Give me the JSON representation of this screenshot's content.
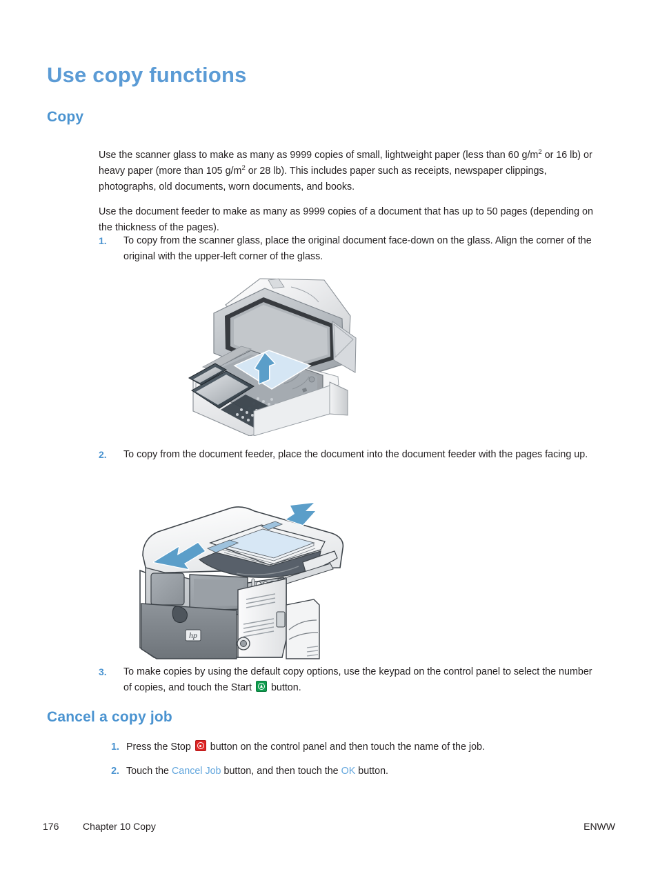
{
  "document": {
    "title": "Use copy functions",
    "sections": [
      {
        "id": "copy",
        "heading": "Copy"
      },
      {
        "id": "cancel",
        "heading": "Cancel a copy job"
      }
    ]
  },
  "copy_section": {
    "heading": "Copy",
    "paragraph_1_part1": "Use the scanner glass to make as many as 9999 copies of small, lightweight paper (less than 60 g/m",
    "paragraph_1_sup1": "2",
    "paragraph_1_part2": " or 16 lb) or heavy paper (more than 105 g/m",
    "paragraph_1_sup2": "2",
    "paragraph_1_part3": " or 28 lb). This includes paper such as receipts, newspaper clippings, photographs, old documents, worn documents, and books.",
    "paragraph_2": "Use the document feeder to make as many as 9999 copies of a document that has up to 50 pages (depending on the thickness of the pages).",
    "steps": [
      {
        "number": "1.",
        "text": "To copy from the scanner glass, place the original document face-down on the glass. Align the corner of the original with the upper-left corner of the glass."
      },
      {
        "number": "2.",
        "text": "To copy from the document feeder, place the document into the document feeder with the pages facing up."
      },
      {
        "number": "3.",
        "text_before": "To make copies by using the default copy options, use the keypad on the control panel to select the number of copies, and touch the Start",
        "text_after": "button."
      }
    ]
  },
  "cancel_section": {
    "heading": "Cancel a copy job",
    "steps": [
      {
        "number": "1.",
        "text_before": "Press the Stop",
        "text_after": "button on the control panel and then touch the name of the job."
      },
      {
        "number": "2.",
        "text_before": "Touch the",
        "ui_1": "Cancel Job",
        "text_middle": "button, and then touch the",
        "ui_2": "OK",
        "text_after": "button."
      }
    ]
  },
  "illustrations": {
    "scanner_glass": {
      "alt": "Flatbed scanner with lid open showing original document placed face-down on the glass with an upward arrow",
      "icon": "scanner-glass-illustration"
    },
    "document_feeder": {
      "alt": "Multifunction printer with document feeder loaded with pages facing up, two arrows pointing at the feeder tray",
      "icon": "document-feeder-illustration"
    }
  },
  "icons": {
    "start_button": "start-button-icon",
    "stop_button": "stop-button-icon",
    "hp_logo": "hp-logo-icon"
  },
  "footer": {
    "page_number": "176",
    "chapter": "Chapter 10   Copy",
    "locale": "ENWW"
  },
  "colors": {
    "heading_blue": "#5b9bd5",
    "subheading_blue": "#4a93d0",
    "ui_link_blue": "#62a6dd",
    "body_text": "#231f20",
    "start_green": "#0f9d4f",
    "stop_red": "#e02424",
    "arrow_blue": "#5b9ec9"
  }
}
